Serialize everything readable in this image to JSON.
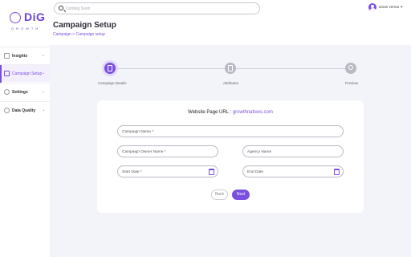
{
  "brand": {
    "name": "DiG",
    "tagline": "GROWTH"
  },
  "search": {
    "placeholder": "Coming Soon"
  },
  "user": {
    "name": "aman verma"
  },
  "page": {
    "title": "Campaign Setup",
    "breadcrumb": "Campaign > Campaign setup"
  },
  "sidebar": {
    "items": [
      {
        "label": "Insights",
        "active": false
      },
      {
        "label": "Campaign Setup",
        "active": true
      },
      {
        "label": "Settings",
        "active": false
      },
      {
        "label": "Data Quality",
        "active": false
      }
    ]
  },
  "stepper": {
    "steps": [
      {
        "label": "Campaign Details",
        "active": true
      },
      {
        "label": "Attributes",
        "active": false
      },
      {
        "label": "Preview",
        "active": false
      }
    ]
  },
  "form": {
    "url_label": "Website Page URL :",
    "url_value": "growthnatives.com",
    "campaign_name": "Campaign Name *",
    "owner_name": "Campaign Owner Name *",
    "agency_name": "Agency Name",
    "start_date": "Start Date *",
    "end_date": "End Date",
    "back_label": "Back",
    "next_label": "Next"
  },
  "colors": {
    "accent": "#7b4fe0",
    "background": "#f3f3fa"
  }
}
